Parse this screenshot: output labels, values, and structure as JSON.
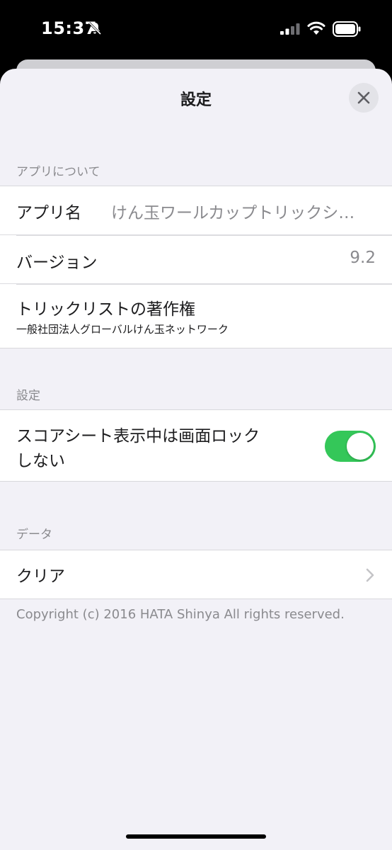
{
  "status_bar": {
    "time": "15:37",
    "icons": [
      "bell-slash-icon",
      "signal-icon",
      "wifi-icon",
      "battery-icon"
    ]
  },
  "sheet": {
    "title": "設定",
    "close_icon": "close-icon"
  },
  "sections": {
    "about": {
      "header": "アプリについて",
      "app_name_label": "アプリ名",
      "app_name_value": "けん玉ワールカップトリックシ…",
      "version_label": "バージョン",
      "version_value": "9.2",
      "copyright_label": "トリックリストの著作権",
      "copyright_value": "一般社団法人グローバルけん玉ネットワーク"
    },
    "settings": {
      "header": "設定",
      "lock_label_line1": "スコアシート表示中は画面ロック",
      "lock_label_line2": "しない",
      "lock_toggle_on": true
    },
    "data": {
      "header": "データ",
      "clear_label": "クリア"
    }
  },
  "footer": {
    "copyright": "Copyright (c) 2016 HATA Shinya All rights reserved."
  },
  "colors": {
    "toggle_on": "#34c759",
    "background": "#f2f1f7",
    "secondary_text": "#8a8a8e"
  }
}
